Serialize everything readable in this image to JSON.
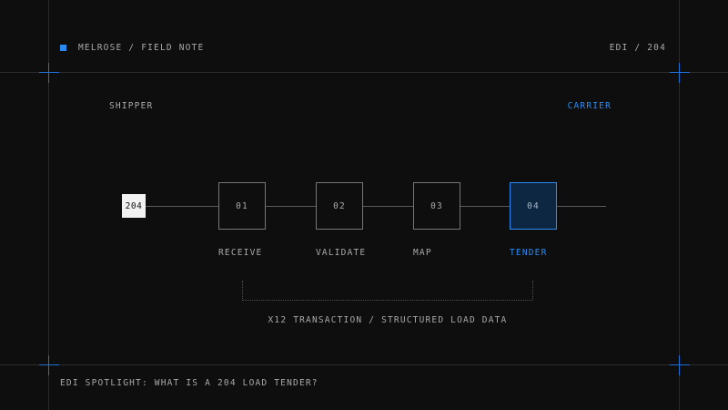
{
  "header": {
    "brand": "MELROSE / FIELD NOTE",
    "doc_code": "EDI / 204"
  },
  "parties": {
    "origin": "SHIPPER",
    "destination": "CARRIER"
  },
  "document": {
    "badge": "204"
  },
  "steps": [
    {
      "number": "01",
      "label": "RECEIVE",
      "active": false
    },
    {
      "number": "02",
      "label": "VALIDATE",
      "active": false
    },
    {
      "number": "03",
      "label": "MAP",
      "active": false
    },
    {
      "number": "04",
      "label": "TENDER",
      "active": true
    }
  ],
  "annotation": "X12 TRANSACTION / STRUCTURED LOAD DATA",
  "footer": {
    "caption": "EDI SPOTLIGHT: WHAT IS A 204 LOAD TENDER?"
  },
  "colors": {
    "accent": "#2a8bf2",
    "active_fill": "#0d2742",
    "background": "#0e0e0e"
  },
  "icons": [
    "crosshair-icon",
    "brand-square-icon"
  ]
}
